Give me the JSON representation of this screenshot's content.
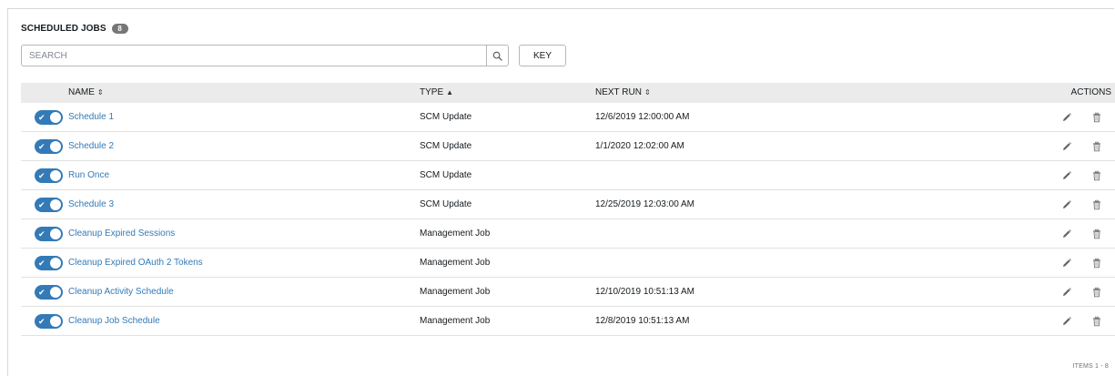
{
  "panel": {
    "title": "SCHEDULED JOBS",
    "count": "8"
  },
  "search": {
    "placeholder": "SEARCH",
    "value": "",
    "icon": "search-icon"
  },
  "key_button": {
    "label": "KEY"
  },
  "table": {
    "columns": {
      "name": "NAME",
      "type": "TYPE",
      "next_run": "NEXT RUN",
      "actions": "ACTIONS"
    },
    "sort_indicators": {
      "name": "⇕",
      "type": "▲",
      "next_run": "⇕"
    },
    "rows": [
      {
        "name": "Schedule 1",
        "type": "SCM Update",
        "next_run": "12/6/2019 12:00:00 AM",
        "enabled": true
      },
      {
        "name": "Schedule 2",
        "type": "SCM Update",
        "next_run": "1/1/2020 12:02:00 AM",
        "enabled": true
      },
      {
        "name": "Run Once",
        "type": "SCM Update",
        "next_run": "",
        "enabled": true
      },
      {
        "name": "Schedule 3",
        "type": "SCM Update",
        "next_run": "12/25/2019 12:03:00 AM",
        "enabled": true
      },
      {
        "name": "Cleanup Expired Sessions",
        "type": "Management Job",
        "next_run": "",
        "enabled": true
      },
      {
        "name": "Cleanup Expired OAuth 2 Tokens",
        "type": "Management Job",
        "next_run": "",
        "enabled": true
      },
      {
        "name": "Cleanup Activity Schedule",
        "type": "Management Job",
        "next_run": "12/10/2019 10:51:13 AM",
        "enabled": true
      },
      {
        "name": "Cleanup Job Schedule",
        "type": "Management Job",
        "next_run": "12/8/2019 10:51:13 AM",
        "enabled": true
      }
    ]
  },
  "footer": {
    "items_text": "ITEMS 1 - 8"
  },
  "colors": {
    "accent": "#337ab7",
    "header_bg": "#ebebeb",
    "badge_bg": "#767676"
  }
}
